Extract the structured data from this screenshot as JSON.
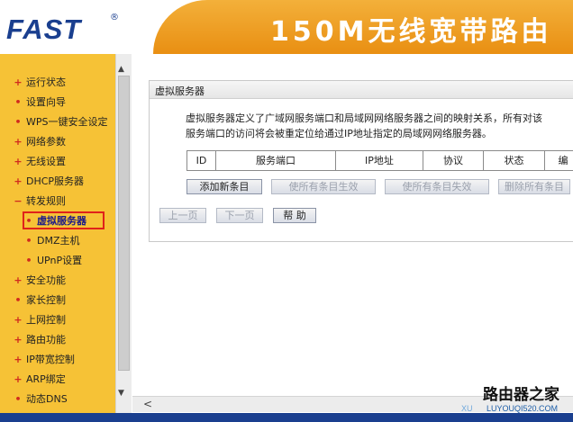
{
  "header": {
    "logo": "FAST",
    "logo_mark": "®",
    "banner_title": "150M无线宽带路由"
  },
  "sidebar": {
    "items": [
      {
        "label": "运行状态",
        "bullet": "+"
      },
      {
        "label": "设置向导",
        "bullet": "•"
      },
      {
        "label": "WPS一键安全设定",
        "bullet": "•"
      },
      {
        "label": "网络参数",
        "bullet": "+"
      },
      {
        "label": "无线设置",
        "bullet": "+"
      },
      {
        "label": "DHCP服务器",
        "bullet": "+"
      },
      {
        "label": "转发规则",
        "bullet": "−"
      },
      {
        "label": "虚拟服务器",
        "bullet": "•",
        "sub": true,
        "active": true
      },
      {
        "label": "DMZ主机",
        "bullet": "•",
        "sub": true
      },
      {
        "label": "UPnP设置",
        "bullet": "•",
        "sub": true
      },
      {
        "label": "安全功能",
        "bullet": "+"
      },
      {
        "label": "家长控制",
        "bullet": "•"
      },
      {
        "label": "上网控制",
        "bullet": "+"
      },
      {
        "label": "路由功能",
        "bullet": "+"
      },
      {
        "label": "IP带宽控制",
        "bullet": "+"
      },
      {
        "label": "ARP绑定",
        "bullet": "+"
      },
      {
        "label": "动态DNS",
        "bullet": "•"
      }
    ]
  },
  "panel": {
    "title": "虚拟服务器",
    "desc_line1": "虚拟服务器定义了广域网服务端口和局域网网络服务器之间的映射关系，所有对该",
    "desc_line2": "服务端口的访问将会被重定位给通过IP地址指定的局域网网络服务器。",
    "columns": [
      "ID",
      "服务端口",
      "IP地址",
      "协议",
      "状态",
      "编"
    ],
    "buttons": {
      "add": "添加新条目",
      "enable_all": "使所有条目生效",
      "disable_all": "使所有条目失效",
      "delete_all": "删除所有条目"
    },
    "pager": {
      "prev": "上一页",
      "next": "下一页",
      "help": "帮 助"
    }
  },
  "watermark": {
    "line1": "路由器之家",
    "line2": "LUYOUQI520.COM",
    "line3": "XU"
  },
  "colors": {
    "banner_orange": "#e98f12",
    "sidebar_yellow": "#f6c236",
    "brand_blue": "#1a3f8f",
    "active_red": "#e0221a"
  }
}
